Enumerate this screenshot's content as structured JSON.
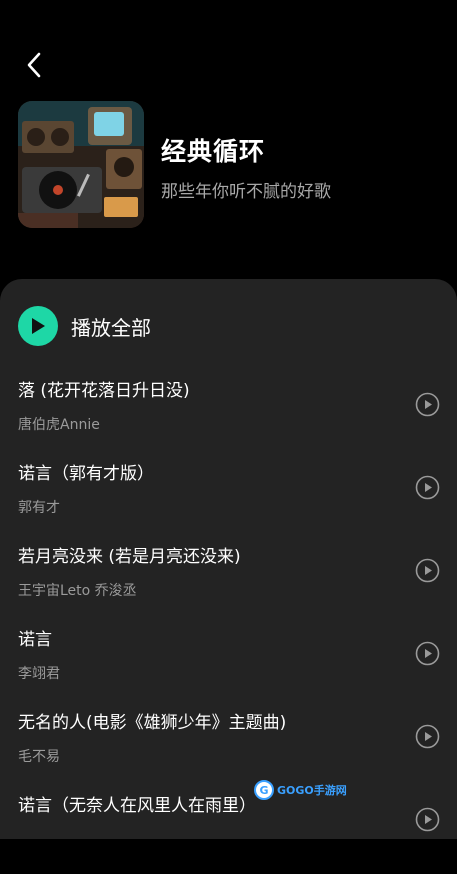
{
  "header": {
    "back_icon": "chevron-left-icon"
  },
  "playlist": {
    "title": "经典循环",
    "subtitle": "那些年你听不腻的好歌",
    "cover_icon": "retro-music-cover-image"
  },
  "play_all": {
    "label": "播放全部",
    "icon": "play-icon",
    "accent_color": "#1ed7a6"
  },
  "songs": [
    {
      "title": "落 (花开花落日升日没)",
      "artist": "唐伯虎Annie"
    },
    {
      "title": "诺言（郭有才版）",
      "artist": "郭有才"
    },
    {
      "title": "若月亮没来 (若是月亮还没来)",
      "artist": "王宇宙Leto 乔浚丞"
    },
    {
      "title": "诺言",
      "artist": "李翊君"
    },
    {
      "title": "无名的人(电影《雄狮少年》主题曲)",
      "artist": "毛不易"
    },
    {
      "title": "诺言（无奈人在风里人在雨里）",
      "artist": ""
    }
  ],
  "watermark": {
    "text": "GOGO手游网"
  }
}
